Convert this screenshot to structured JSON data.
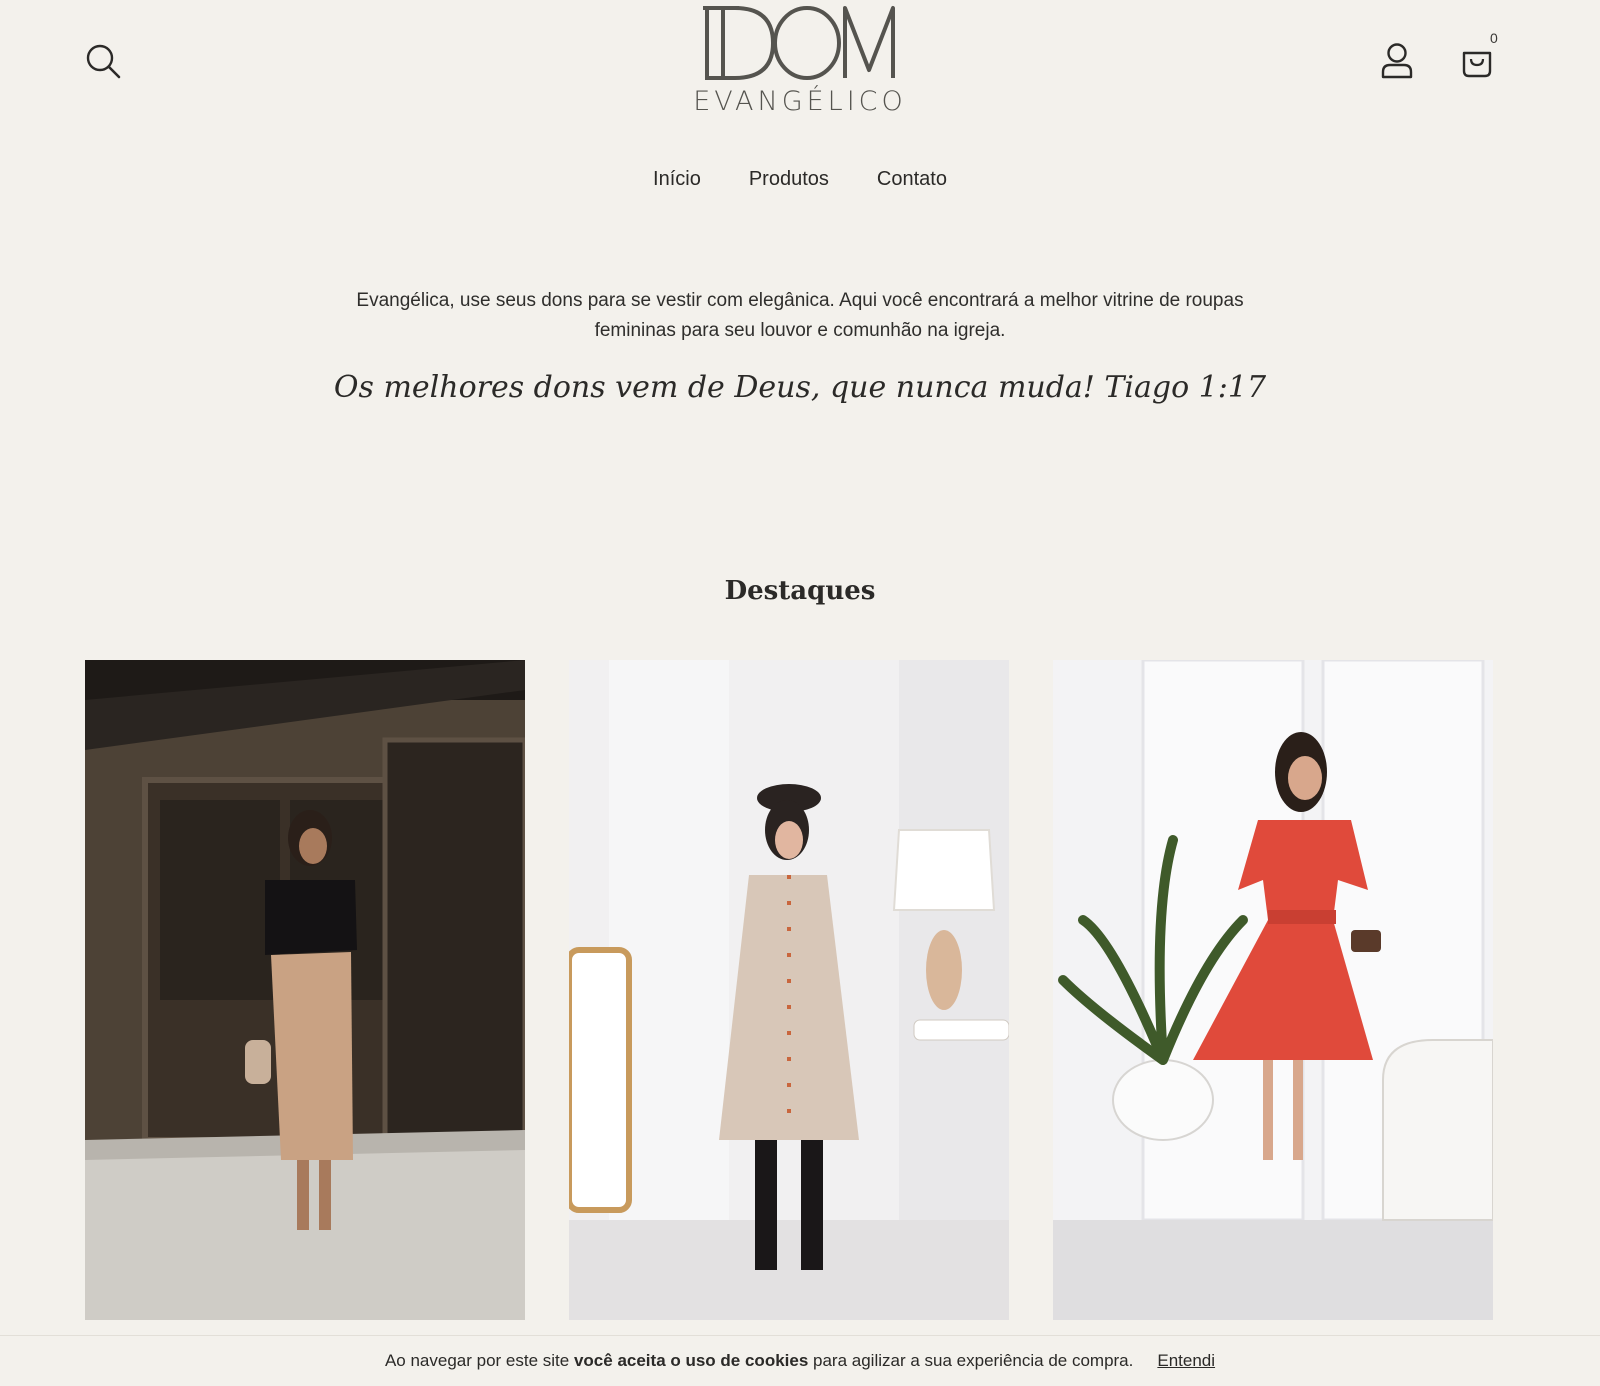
{
  "header": {
    "logo_sub": "EVANGÉLICO",
    "logo_mark": "DOM",
    "cart_count": "0",
    "icons": {
      "search": "search-icon",
      "account": "user-icon",
      "cart": "shopping-bag-icon"
    }
  },
  "nav": {
    "items": [
      {
        "label": "Início"
      },
      {
        "label": "Produtos"
      },
      {
        "label": "Contato"
      }
    ]
  },
  "intro": {
    "text": "Evangélica, use seus dons para se vestir com elegânica. Aqui você encontrará a melhor vitrine de roupas femininas para seu louvor e comunhão na igreja.",
    "quote": "Os melhores dons vem de Deus, que nunca muda! Tiago 1:17"
  },
  "highlights": {
    "title": "Destaques"
  },
  "cookie": {
    "text_before": "Ao navegar por este site ",
    "text_bold": "você aceita o uso de cookies",
    "text_after": " para agilizar a sua experiência de compra.",
    "accept_label": "Entendi"
  },
  "colors": {
    "background": "#f3f1ec",
    "text": "#2b2a28",
    "logo": "#55544f"
  }
}
